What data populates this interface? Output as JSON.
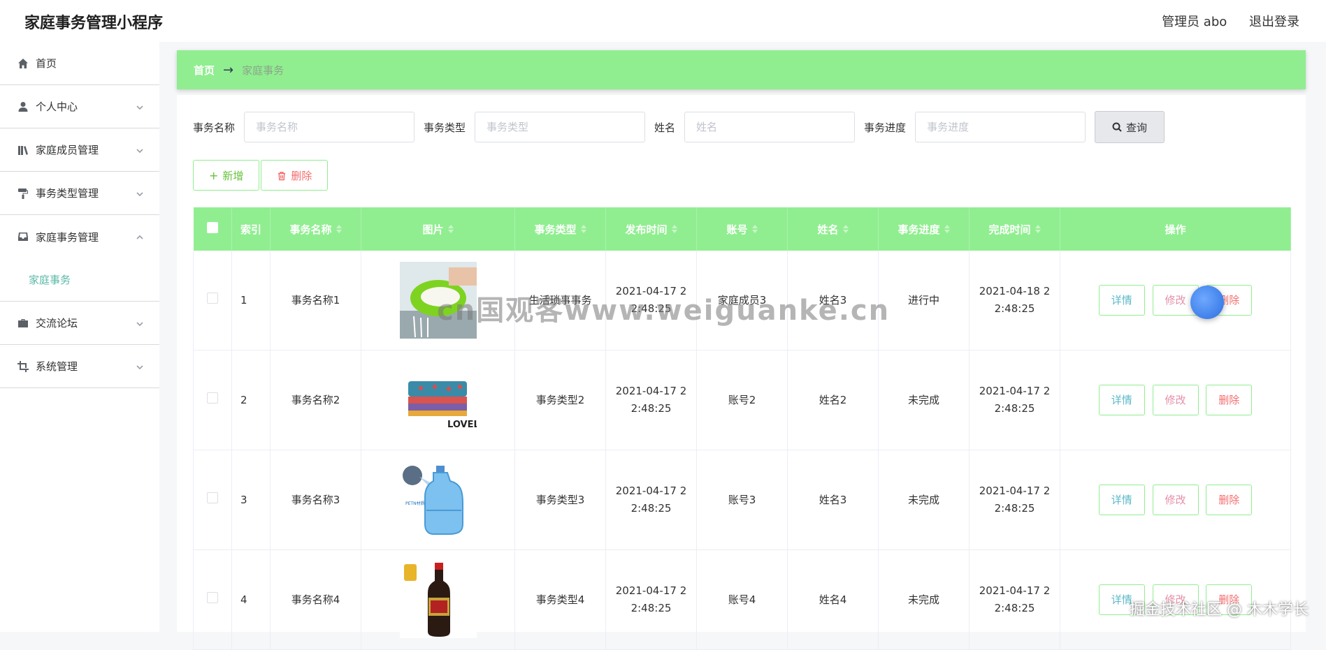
{
  "app": {
    "title": "家庭事务管理小程序"
  },
  "header": {
    "user_label": "管理员 abo",
    "logout_label": "退出登录"
  },
  "sidebar": {
    "items": [
      {
        "label": "首页",
        "icon": "home-icon"
      },
      {
        "label": "个人中心",
        "icon": "user-icon"
      },
      {
        "label": "家庭成员管理",
        "icon": "books-icon"
      },
      {
        "label": "事务类型管理",
        "icon": "paint-roller-icon"
      },
      {
        "label": "家庭事务管理",
        "icon": "inbox-icon"
      },
      {
        "label": "交流论坛",
        "icon": "briefcase-icon"
      },
      {
        "label": "系统管理",
        "icon": "crop-icon"
      }
    ],
    "submenu_label": "家庭事务"
  },
  "breadcrumb": {
    "home": "首页",
    "arrow": "→",
    "current": "家庭事务"
  },
  "search": {
    "name_label": "事务名称",
    "name_placeholder": "事务名称",
    "type_label": "事务类型",
    "type_placeholder": "事务类型",
    "person_label": "姓名",
    "person_placeholder": "姓名",
    "progress_label": "事务进度",
    "progress_placeholder": "事务进度",
    "query_label": "查询"
  },
  "actions": {
    "add_label": "新增",
    "delete_label": "删除"
  },
  "table": {
    "headers": [
      "索引",
      "事务名称",
      "图片",
      "事务类型",
      "发布时间",
      "账号",
      "姓名",
      "事务进度",
      "完成时间",
      "操作"
    ],
    "rows": [
      {
        "index": "1",
        "name": "事务名称1",
        "type": "生活琐事事务",
        "publish": "2021-04-17 2\n2:48:25",
        "account": "家庭成员3",
        "person": "姓名3",
        "progress": "进行中",
        "finish": "2021-04-18 2\n2:48:25"
      },
      {
        "index": "2",
        "name": "事务名称2",
        "type": "事务类型2",
        "publish": "2021-04-17 2\n2:48:25",
        "account": "账号2",
        "person": "姓名2",
        "progress": "未完成",
        "finish": "2021-04-17 2\n2:48:25"
      },
      {
        "index": "3",
        "name": "事务名称3",
        "type": "事务类型3",
        "publish": "2021-04-17 2\n2:48:25",
        "account": "账号3",
        "person": "姓名3",
        "progress": "未完成",
        "finish": "2021-04-17 2\n2:48:25"
      },
      {
        "index": "4",
        "name": "事务名称4",
        "type": "事务类型4",
        "publish": "2021-04-17 2\n2:48:25",
        "account": "账号4",
        "person": "姓名4",
        "progress": "未完成",
        "finish": "2021-04-17 2\n2:48:25"
      }
    ],
    "op_detail": "详情",
    "op_edit": "修改",
    "op_delete": "删除"
  },
  "watermark": "cn国观客www.weiguanke.cn",
  "footer_mark": "掘金技术社区 @ 木木学长",
  "colors": {
    "accent": "#90ee90",
    "submenu": "#5ab8a8",
    "danger": "#f56c6c"
  }
}
